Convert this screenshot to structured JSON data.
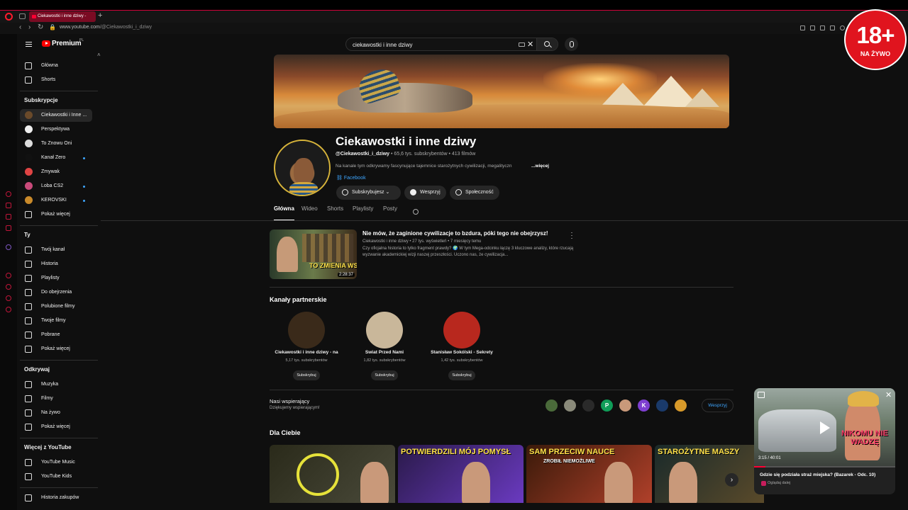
{
  "browser": {
    "tab_title": "Ciekawostki i inne dziwy -",
    "new_tab": "+",
    "url_host": "www.youtube.com",
    "url_path": "/@Ciekawostki_i_dziwy"
  },
  "sidebar": {
    "brand": "Premium",
    "region": "PL",
    "primary": [
      {
        "label": "Główna",
        "icon": "home-icon"
      },
      {
        "label": "Shorts",
        "icon": "shorts-icon"
      }
    ],
    "subscriptions_title": "Subskrypcje",
    "subscriptions": [
      {
        "label": "Ciekawostki i Inne ...",
        "active": true,
        "dot": false,
        "color": "#6a4a2a"
      },
      {
        "label": "Perspektywa",
        "active": false,
        "dot": false,
        "color": "#eeeeee"
      },
      {
        "label": "To Znowu Oni",
        "active": false,
        "dot": false,
        "color": "#dddddd"
      },
      {
        "label": "Kanał Zero",
        "active": false,
        "dot": true,
        "color": "#111111"
      },
      {
        "label": "Zmywak",
        "active": false,
        "dot": false,
        "color": "#e04444"
      },
      {
        "label": "Loba CS2",
        "active": false,
        "dot": true,
        "color": "#c94a7a"
      },
      {
        "label": "KEROVSKI",
        "active": false,
        "dot": true,
        "color": "#c98a2a"
      }
    ],
    "subs_more": "Pokaż więcej",
    "you_title": "Ty",
    "you_items": [
      {
        "label": "Twój kanał",
        "icon": "channel-icon"
      },
      {
        "label": "Historia",
        "icon": "history-icon"
      },
      {
        "label": "Playlisty",
        "icon": "playlist-icon"
      },
      {
        "label": "Do obejrzenia",
        "icon": "watch-later-icon"
      },
      {
        "label": "Polubione filmy",
        "icon": "like-icon"
      },
      {
        "label": "Twoje filmy",
        "icon": "your-videos-icon"
      },
      {
        "label": "Pobrane",
        "icon": "download-icon"
      }
    ],
    "you_more": "Pokaż więcej",
    "explore_title": "Odkrywaj",
    "explore_items": [
      {
        "label": "Muzyka",
        "icon": "music-icon"
      },
      {
        "label": "Filmy",
        "icon": "film-icon"
      },
      {
        "label": "Na żywo",
        "icon": "live-icon"
      }
    ],
    "explore_more": "Pokaż więcej",
    "more_title": "Więcej z YouTube",
    "more_items": [
      {
        "label": "YouTube Music",
        "icon": "youtube-music-icon"
      },
      {
        "label": "YouTube Kids",
        "icon": "youtube-kids-icon"
      }
    ],
    "cut_item": "Historia zakupów"
  },
  "search": {
    "query": "ciekawostki i inne dziwy"
  },
  "channel": {
    "name": "Ciekawostki i inne dziwy",
    "handle": "@Ciekawostki_i_dziwy",
    "subs": "65,6 tys. subskrybentów",
    "videos": "413 filmów",
    "description": "Na kanale tym odkrywamy fascynujące tajemnice starożytnych cywilizacji, megalityczn",
    "more": "...więcej",
    "link": "Facebook",
    "buttons": {
      "subscribed": "Subskrybujesz",
      "support": "Wesprzyj",
      "community": "Społeczność"
    },
    "tabs": [
      "Główna",
      "Wideo",
      "Shorts",
      "Playlisty",
      "Posty"
    ]
  },
  "featured": {
    "title": "Nie mów, że zaginione cywilizacje to bzdura, póki tego nie obejrzysz!",
    "meta": "Ciekawostki i inne dziwy • 27 tys. wyświetleń • 7 miesięcy temu",
    "desc": "Czy oficjalna historia to tylko fragment prawdy? 🌍 W tym Mega-odcinku łączę 3 kluczowe analizy, które rzucają wyzwanie akademickiej wizji naszej przeszłości. Uczono nas, że cywilizacja...",
    "thumb_text": "TO ZMIENIA WSZYST",
    "duration": "2:28:37"
  },
  "partners": {
    "title": "Kanały partnerskie",
    "items": [
      {
        "name": "Ciekawostki i inne dziwy - na",
        "subs": "5,17 tys. subskrybentów",
        "btn": "Subskrybuj",
        "color": "#3a2a1a"
      },
      {
        "name": "Świat Przed Nami",
        "subs": "1,82 tys. subskrybentów",
        "btn": "Subskrybuj",
        "color": "#c9b79a"
      },
      {
        "name": "Stanisław Sokólski - Sekrety",
        "subs": "1,42 tys. subskrybentów",
        "btn": "Subskrybuj",
        "color": "#b8281e"
      }
    ]
  },
  "supporters": {
    "title": "Nasi wspierający",
    "subtitle": "Dziękujemy wspierającym!",
    "button": "Wesprzyj",
    "avatars": [
      {
        "letter": "",
        "color": "#4a6a3a"
      },
      {
        "letter": "",
        "color": "#8a8a7a"
      },
      {
        "letter": "",
        "color": "#2a2a2a"
      },
      {
        "letter": "P",
        "color": "#0f9d58"
      },
      {
        "letter": "",
        "color": "#c9997a"
      },
      {
        "letter": "K",
        "color": "#7e3fd0"
      },
      {
        "letter": "",
        "color": "#1a3a6a"
      },
      {
        "letter": "",
        "color": "#d89a2a"
      }
    ]
  },
  "for_you": {
    "title": "Dla Ciebie",
    "items": [
      {
        "label": "",
        "color1": "#2a2a1a",
        "color2": "#4a4a3a",
        "label_color": "#ffe14a"
      },
      {
        "label": "POTWIERDZILI MÓJ POMYSŁ",
        "color1": "#2a1a4a",
        "color2": "#6a3ac0",
        "label_color": "#ffe14a"
      },
      {
        "label": "SAM PRZECIW NAUCE",
        "color1": "#3a1a0a",
        "color2": "#b0402a",
        "label_color": "#ffe14a"
      },
      {
        "label": "STAROŻYTNE MASZY",
        "color1": "#1a2a2a",
        "color2": "#5a4a2a",
        "label_color": "#ffe14a"
      }
    ],
    "thumb2_sub": "ZROBIŁ NIEMOŻLIWE"
  },
  "mini_player": {
    "title": "Gdzie się podziała straż miejska? (Bazarek - Odc. 10)",
    "time": "3:15 / 40:01",
    "sub": "Oglądaj dalej",
    "overlay": "NIKOMU NIE WADZĘ",
    "progress": 0.08
  },
  "badge": {
    "big": "18+",
    "small": "NA ŻYWO"
  }
}
